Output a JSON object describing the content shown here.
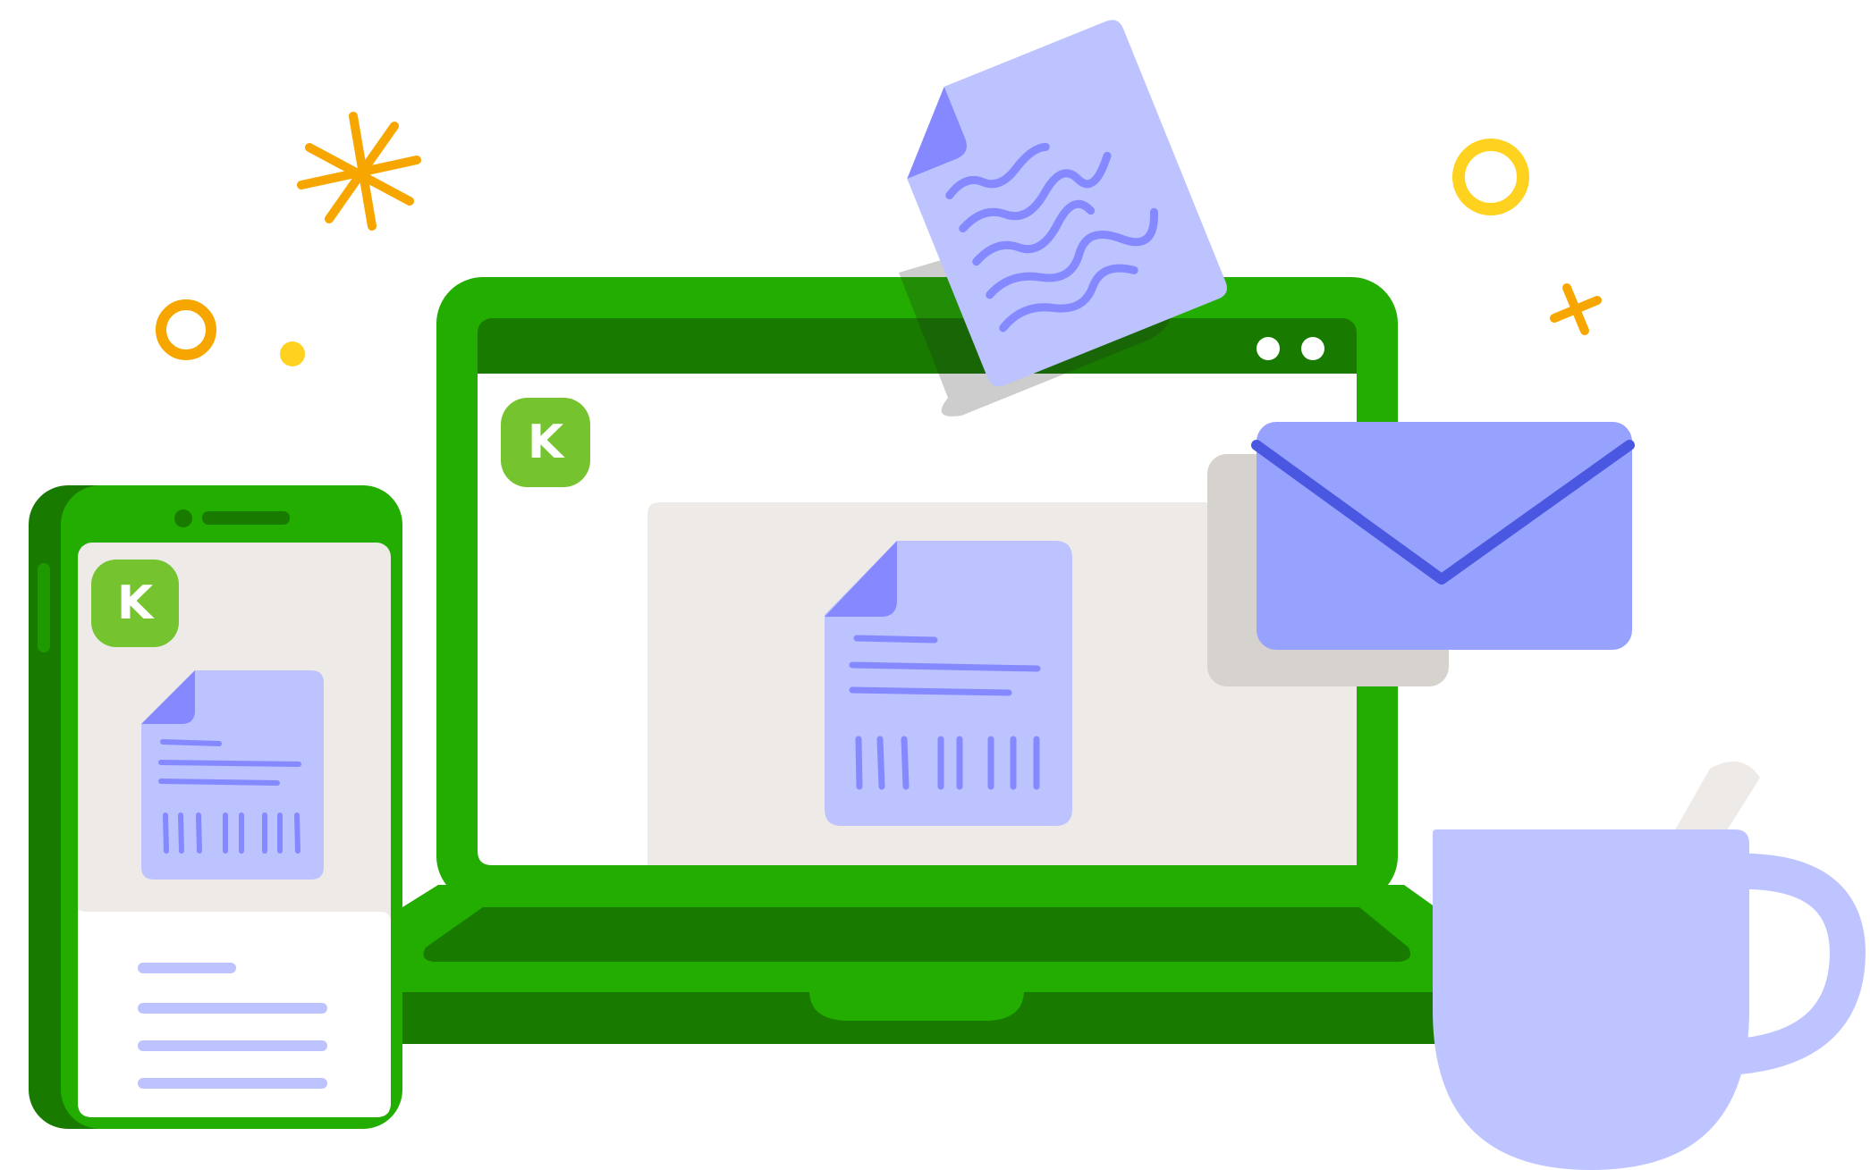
{
  "illustration": {
    "laptop_logo_letter": "K",
    "phone_logo_letter": "K"
  },
  "colors": {
    "device_green": "#23ad00",
    "device_dark_green": "#187b00",
    "logo_green": "#74c32f",
    "doc_lavender": "#bcc3ff",
    "doc_fold": "#8588ff",
    "doc_lines": "#8589ff",
    "envelope": "#97a2ff",
    "envelope_flap": "#4a57e0",
    "mug": "#bdc4ff",
    "panel_gray": "#edeae8",
    "shadow_gray": "#d6d2ce",
    "accent_orange": "#f7a600",
    "accent_yellow": "#ffd21f"
  },
  "icons": [
    "document-icon",
    "flying-document-icon",
    "envelope-icon",
    "mug-icon",
    "laptop-icon",
    "phone-icon",
    "sparkle-icon",
    "ring-icon",
    "cross-icon"
  ]
}
